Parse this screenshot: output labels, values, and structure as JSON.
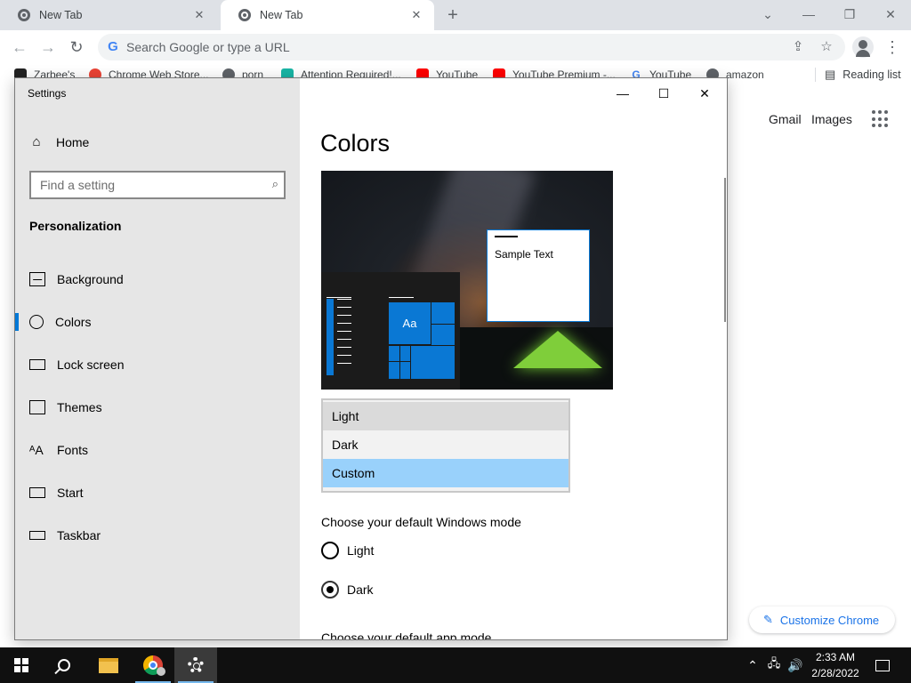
{
  "browser": {
    "tabs": [
      {
        "title": "New Tab"
      },
      {
        "title": "New Tab"
      }
    ],
    "omnibox": {
      "placeholder": "Search Google or type a URL"
    },
    "bookmarks": [
      "Zarbee's",
      "Chrome Web Store...",
      "porn",
      "Attention Required!...",
      "YouTube",
      "YouTube Premium -...",
      "YouTube",
      "amazon"
    ],
    "reading_list": "Reading list"
  },
  "ntp": {
    "gmail": "Gmail",
    "images": "Images",
    "customize": "Customize Chrome"
  },
  "settings": {
    "window_title": "Settings",
    "home": "Home",
    "search_placeholder": "Find a setting",
    "section": "Personalization",
    "nav": [
      {
        "label": "Background",
        "icon": "picture-icon"
      },
      {
        "label": "Colors",
        "icon": "palette-icon",
        "selected": true
      },
      {
        "label": "Lock screen",
        "icon": "lock-screen-icon"
      },
      {
        "label": "Themes",
        "icon": "themes-icon"
      },
      {
        "label": "Fonts",
        "icon": "fonts-icon"
      },
      {
        "label": "Start",
        "icon": "start-icon"
      },
      {
        "label": "Taskbar",
        "icon": "taskbar-icon"
      }
    ],
    "page_title": "Colors",
    "preview": {
      "sample_text": "Sample Text",
      "tile_text": "Aa"
    },
    "color_options": [
      "Light",
      "Dark",
      "Custom"
    ],
    "selected_color_option": "Custom",
    "windows_mode_label": "Choose your default Windows mode",
    "windows_mode_options": [
      {
        "label": "Light",
        "checked": false
      },
      {
        "label": "Dark",
        "checked": true
      }
    ],
    "app_mode_label": "Choose your default app mode"
  },
  "taskbar": {
    "time": "2:33 AM",
    "date": "2/28/2022"
  },
  "colors": {
    "accent": "#0078d7",
    "selected_option": "#99d1fb",
    "taskbar": "#101010"
  }
}
